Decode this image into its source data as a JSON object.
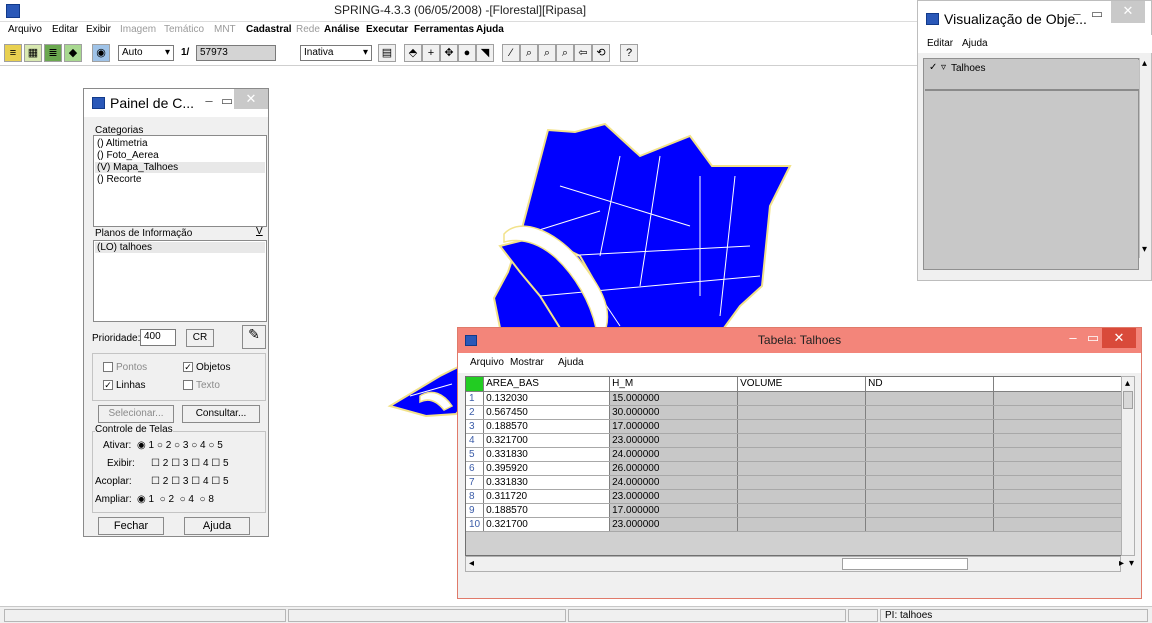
{
  "main": {
    "title": "SPRING-4.3.3 (06/05/2008) -[Florestal][Ripasa]",
    "menu": [
      {
        "label": "Arquivo",
        "style": "normal"
      },
      {
        "label": "Editar",
        "style": "normal"
      },
      {
        "label": "Exibir",
        "style": "normal"
      },
      {
        "label": "Imagem",
        "style": "dim"
      },
      {
        "label": "Temático",
        "style": "dim"
      },
      {
        "label": "MNT",
        "style": "dim"
      },
      {
        "label": "Cadastral",
        "style": "bold"
      },
      {
        "label": "Rede",
        "style": "dim"
      },
      {
        "label": "Análise",
        "style": "bold"
      },
      {
        "label": "Executar",
        "style": "bold"
      },
      {
        "label": "Ferramentas",
        "style": "bold"
      },
      {
        "label": "Ajuda",
        "style": "bold"
      }
    ],
    "toolbar": {
      "zoom_mode": "Auto",
      "scale_prefix": "1/",
      "scale_value": "57973",
      "state": "Inativa"
    }
  },
  "status": {
    "pi": "PI: talhoes"
  },
  "painel": {
    "title": "Painel de C...",
    "categorias_label": "Categorias",
    "categorias": [
      "() Altimetria",
      "() Foto_Aerea",
      "(V) Mapa_Talhoes",
      "() Recorte"
    ],
    "planos_label": "Planos de Informação",
    "planos_toggle": "V",
    "planos": [
      "(LO) talhoes"
    ],
    "prioridade_label": "Prioridade:",
    "prioridade_value": "400",
    "cr_label": "CR",
    "pontos": "Pontos",
    "objetos": "Objetos",
    "linhas": "Linhas",
    "texto": "Texto",
    "selecionar": "Selecionar...",
    "consultar": "Consultar...",
    "controle_label": "Controle de Telas",
    "ativar_label": "Ativar:",
    "exibir_label": "Exibir:",
    "acoplar_label": "Acoplar:",
    "ampliar_label": "Ampliar:",
    "ativar_opts": [
      "1",
      "2",
      "3",
      "4",
      "5"
    ],
    "exibir_opts": [
      "2",
      "3",
      "4",
      "5"
    ],
    "acoplar_opts": [
      "2",
      "3",
      "4",
      "5"
    ],
    "ampliar_opts": [
      "1",
      "2",
      "4",
      "8"
    ],
    "fechar": "Fechar",
    "ajuda": "Ajuda"
  },
  "visualizacao": {
    "title": "Visualização de Obje...",
    "menu": [
      "Editar",
      "Ajuda"
    ],
    "item": "Talhoes"
  },
  "tabela": {
    "title": "Tabela: Talhoes",
    "menu": [
      "Arquivo",
      "Mostrar",
      "Ajuda"
    ],
    "columns": [
      "AREA_BAS",
      "H_M",
      "VOLUME",
      "ND",
      ""
    ],
    "rows": [
      {
        "n": "1",
        "area": "0.132030",
        "h": "15.000000"
      },
      {
        "n": "2",
        "area": "0.567450",
        "h": "30.000000"
      },
      {
        "n": "3",
        "area": "0.188570",
        "h": "17.000000"
      },
      {
        "n": "4",
        "area": "0.321700",
        "h": "23.000000"
      },
      {
        "n": "5",
        "area": "0.331830",
        "h": "24.000000"
      },
      {
        "n": "6",
        "area": "0.395920",
        "h": "26.000000"
      },
      {
        "n": "7",
        "area": "0.331830",
        "h": "24.000000"
      },
      {
        "n": "8",
        "area": "0.311720",
        "h": "23.000000"
      },
      {
        "n": "9",
        "area": "0.188570",
        "h": "17.000000"
      },
      {
        "n": "10",
        "area": "0.321700",
        "h": "23.000000"
      }
    ]
  },
  "colors": {
    "map_fill": "#0000ff",
    "map_outline": "#f2e28a",
    "table_title": "#f3857a",
    "accent": "#2a58b8"
  }
}
